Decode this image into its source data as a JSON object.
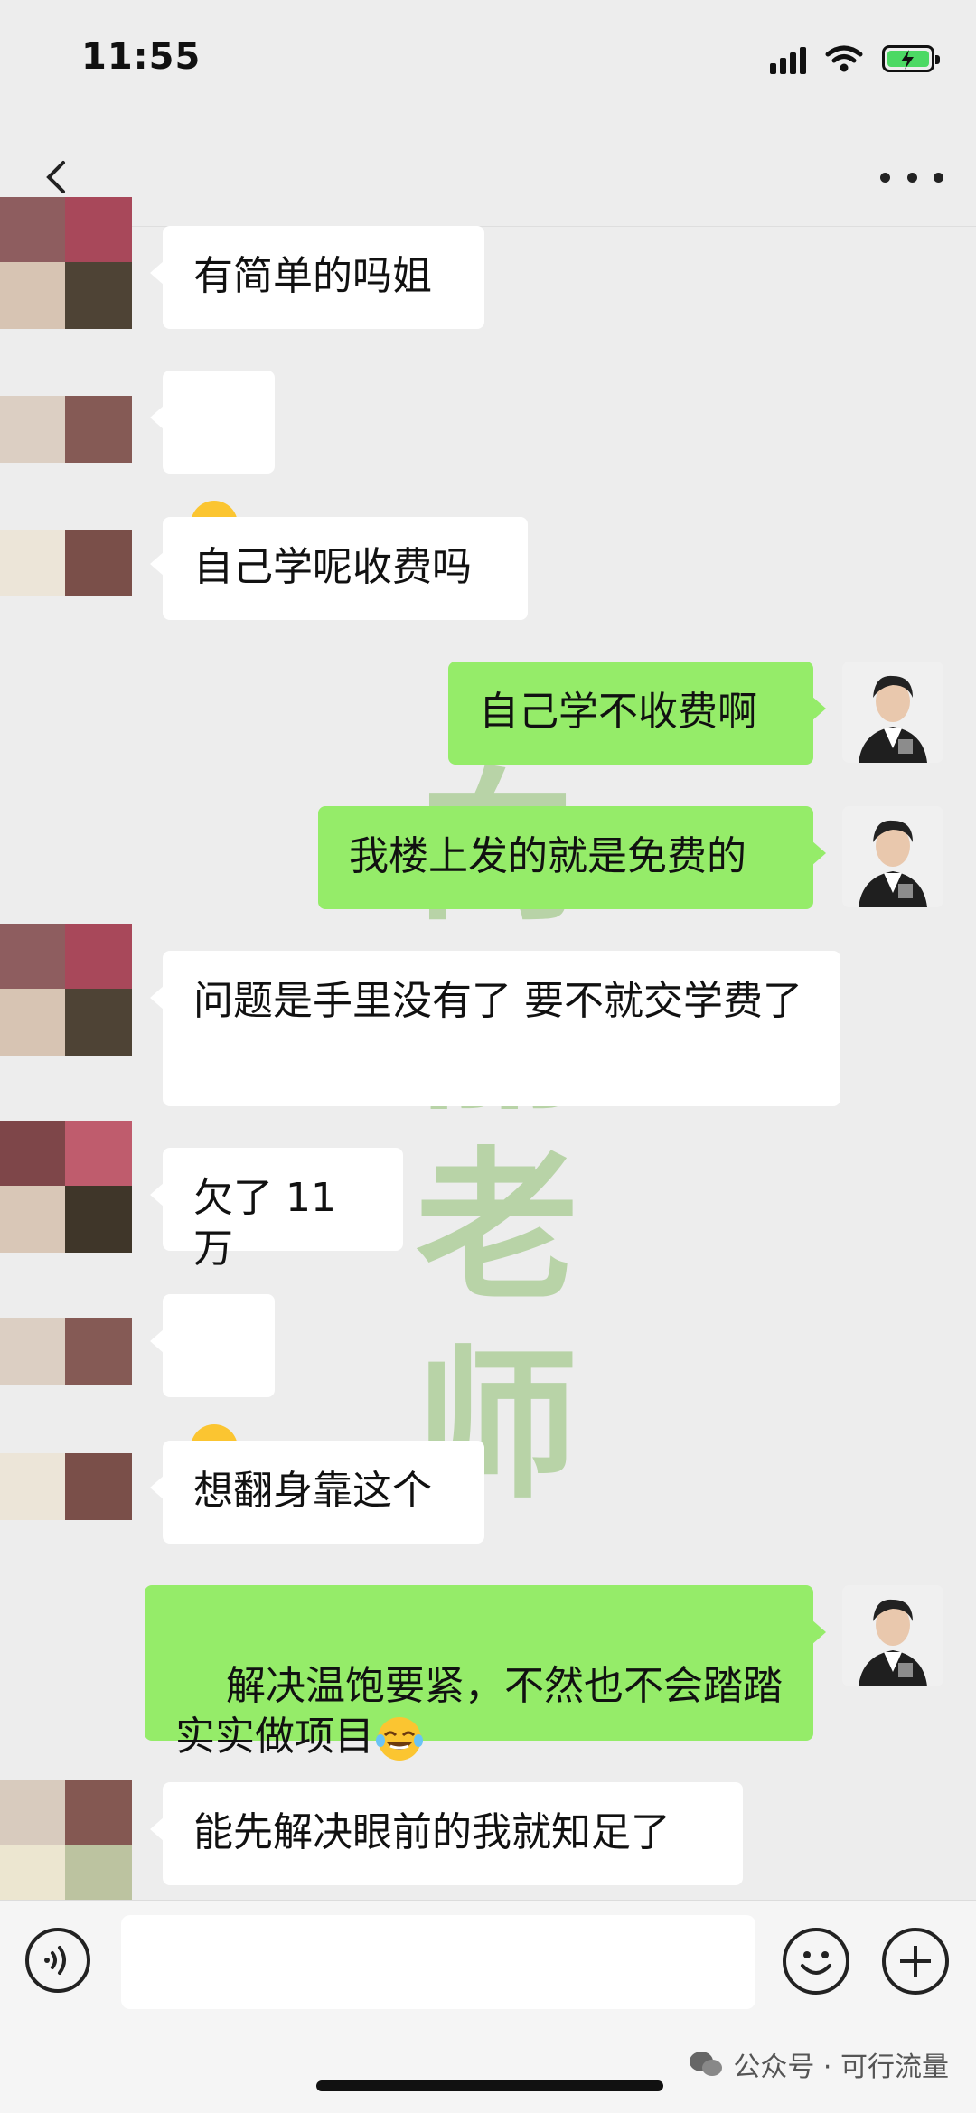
{
  "status_bar": {
    "time": "11:55"
  },
  "colors": {
    "background": "#ededed",
    "incoming_bubble": "#ffffff",
    "outgoing_bubble": "#95ec69",
    "watermark": "#8dbf6f"
  },
  "icons": {
    "back": "chevron-left-icon",
    "more": "ellipsis-icon",
    "voice": "voice-icon",
    "emoji": "smile-icon",
    "plus": "plus-icon"
  },
  "messages": [
    {
      "side": "left",
      "text": "有简单的吗姐"
    },
    {
      "side": "left",
      "text": "",
      "emoji": "facepalm"
    },
    {
      "side": "left",
      "text": "自己学呢收费吗"
    },
    {
      "side": "right",
      "text": "自己学不收费啊"
    },
    {
      "side": "right",
      "text": "我楼上发的就是免费的"
    },
    {
      "side": "left",
      "text": "问题是手里没有了 要不就交学费了"
    },
    {
      "side": "left",
      "text": "欠了 11万"
    },
    {
      "side": "left",
      "text": "",
      "emoji": "facepalm"
    },
    {
      "side": "left",
      "text": "想翻身靠这个"
    },
    {
      "side": "right",
      "text": "解决温饱要紧，不然也不会踏踏实实做项目",
      "emoji": "tears-of-joy"
    },
    {
      "side": "left",
      "text": "能先解决眼前的我就知足了"
    }
  ],
  "watermark": {
    "text": "向丽老师"
  },
  "input_bar": {
    "value": ""
  },
  "source": {
    "label": "公众号 · 可行流量"
  }
}
